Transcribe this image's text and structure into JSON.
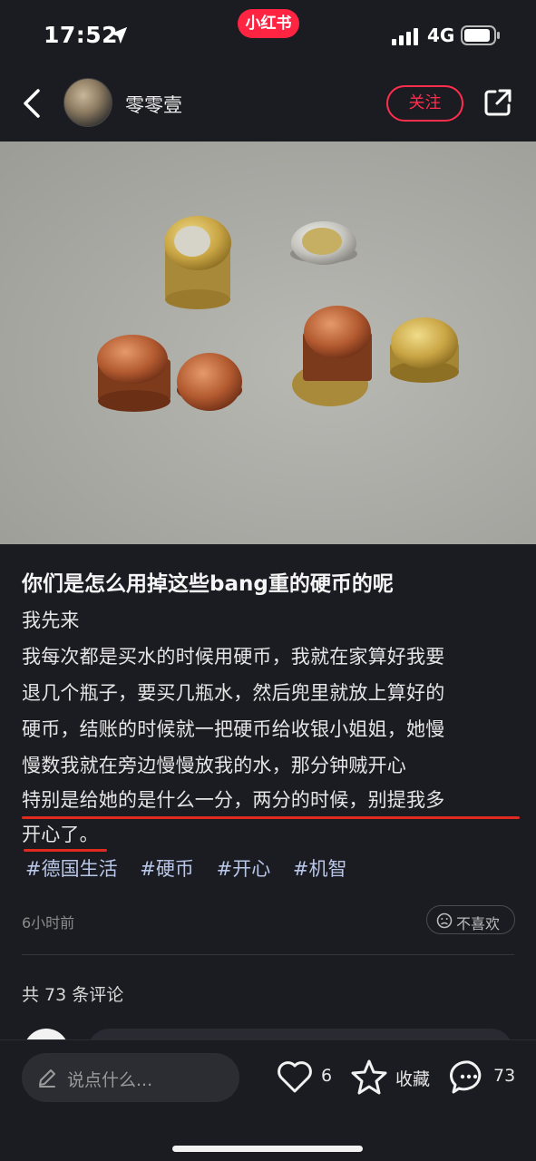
{
  "status_bar": {
    "time": "17:52",
    "brand": "小红书",
    "network": "4G"
  },
  "header": {
    "author_name": "零零壹",
    "follow_label": "关注"
  },
  "post": {
    "title": "你们是怎么用掉这些bang重的硬币的呢",
    "body_lines": [
      "我先来",
      "我每次都是买水的时候用硬币，我就在家算好我要",
      "退几个瓶子，要买几瓶水，然后兜里就放上算好的",
      "硬币，结账的时候就一把硬币给收银小姐姐，她慢",
      "慢数我就在旁边慢慢放我的水，那分钟贼开心",
      "特别是给她的是什么一分，两分的时候，别提我多",
      "开心了。"
    ],
    "tags": [
      "#德国生活",
      "#硬币",
      "#开心",
      "#机智"
    ],
    "posted_time": "6小时前",
    "dislike_label": "不喜欢"
  },
  "comments": {
    "count_text": "共 73 条评论"
  },
  "bottom_bar": {
    "input_placeholder": "说点什么...",
    "like_count": "6",
    "collect_label": "收藏",
    "comment_count": "73"
  },
  "colors": {
    "background": "#1b1b22",
    "accent": "#ff2442",
    "tag": "#b8c7e8",
    "highlight_underline": "#e0291f"
  },
  "icons": [
    "location-arrow-icon",
    "signal-icon",
    "battery-icon",
    "back-icon",
    "share-icon",
    "pen-icon",
    "heart-icon",
    "star-icon",
    "comment-icon",
    "sad-face-icon"
  ]
}
